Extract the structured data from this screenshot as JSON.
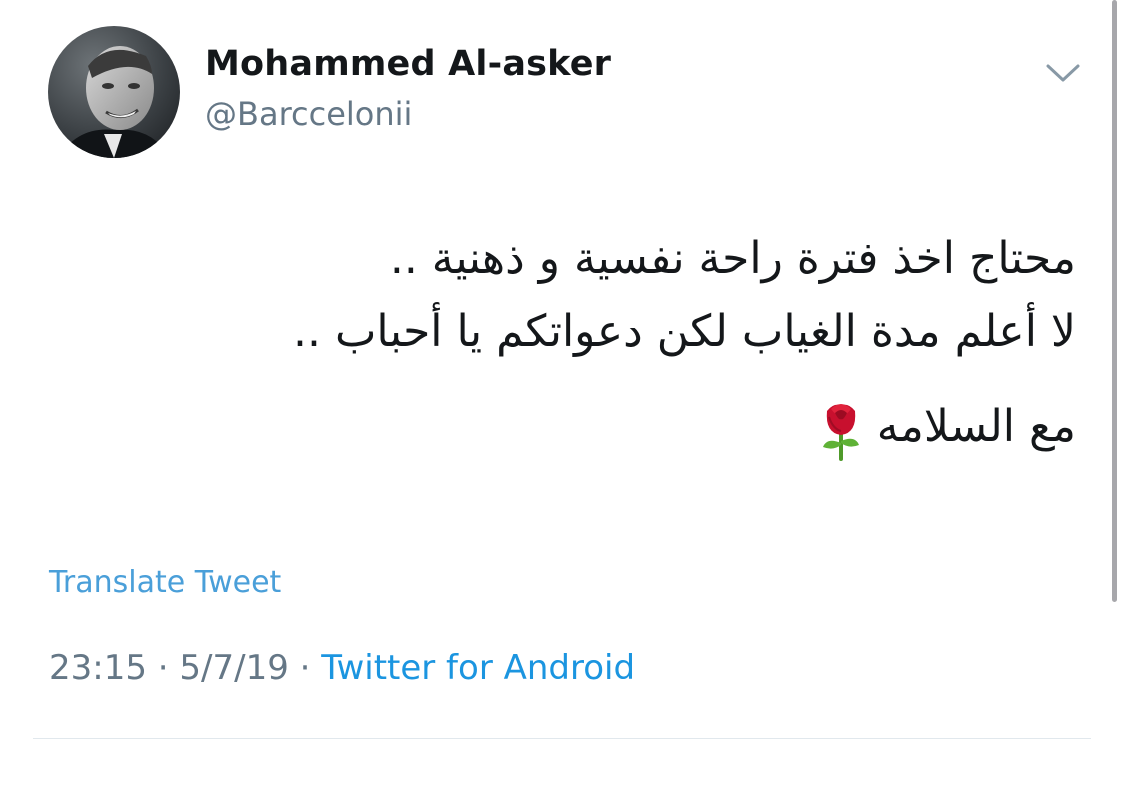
{
  "user": {
    "display_name": "Mohammed Al-asker",
    "handle": "@Barccelonii"
  },
  "tweet": {
    "lines": [
      "محتاج اخذ فترة راحة نفسية و ذهنية ..",
      "لا أعلم مدة الغياب لكن دعواتكم يا أحباب ..",
      "مع السلامه"
    ],
    "emoji": "rose",
    "translate_label": "Translate Tweet"
  },
  "meta": {
    "time": "23:15",
    "separator": "·",
    "date": "5/7/19",
    "source": "Twitter for Android"
  },
  "icons": {
    "menu": "chevron-down-icon",
    "emoji": "rose-icon"
  },
  "colors": {
    "link": "#1b95e0",
    "muted": "#657786",
    "text": "#14171a"
  }
}
